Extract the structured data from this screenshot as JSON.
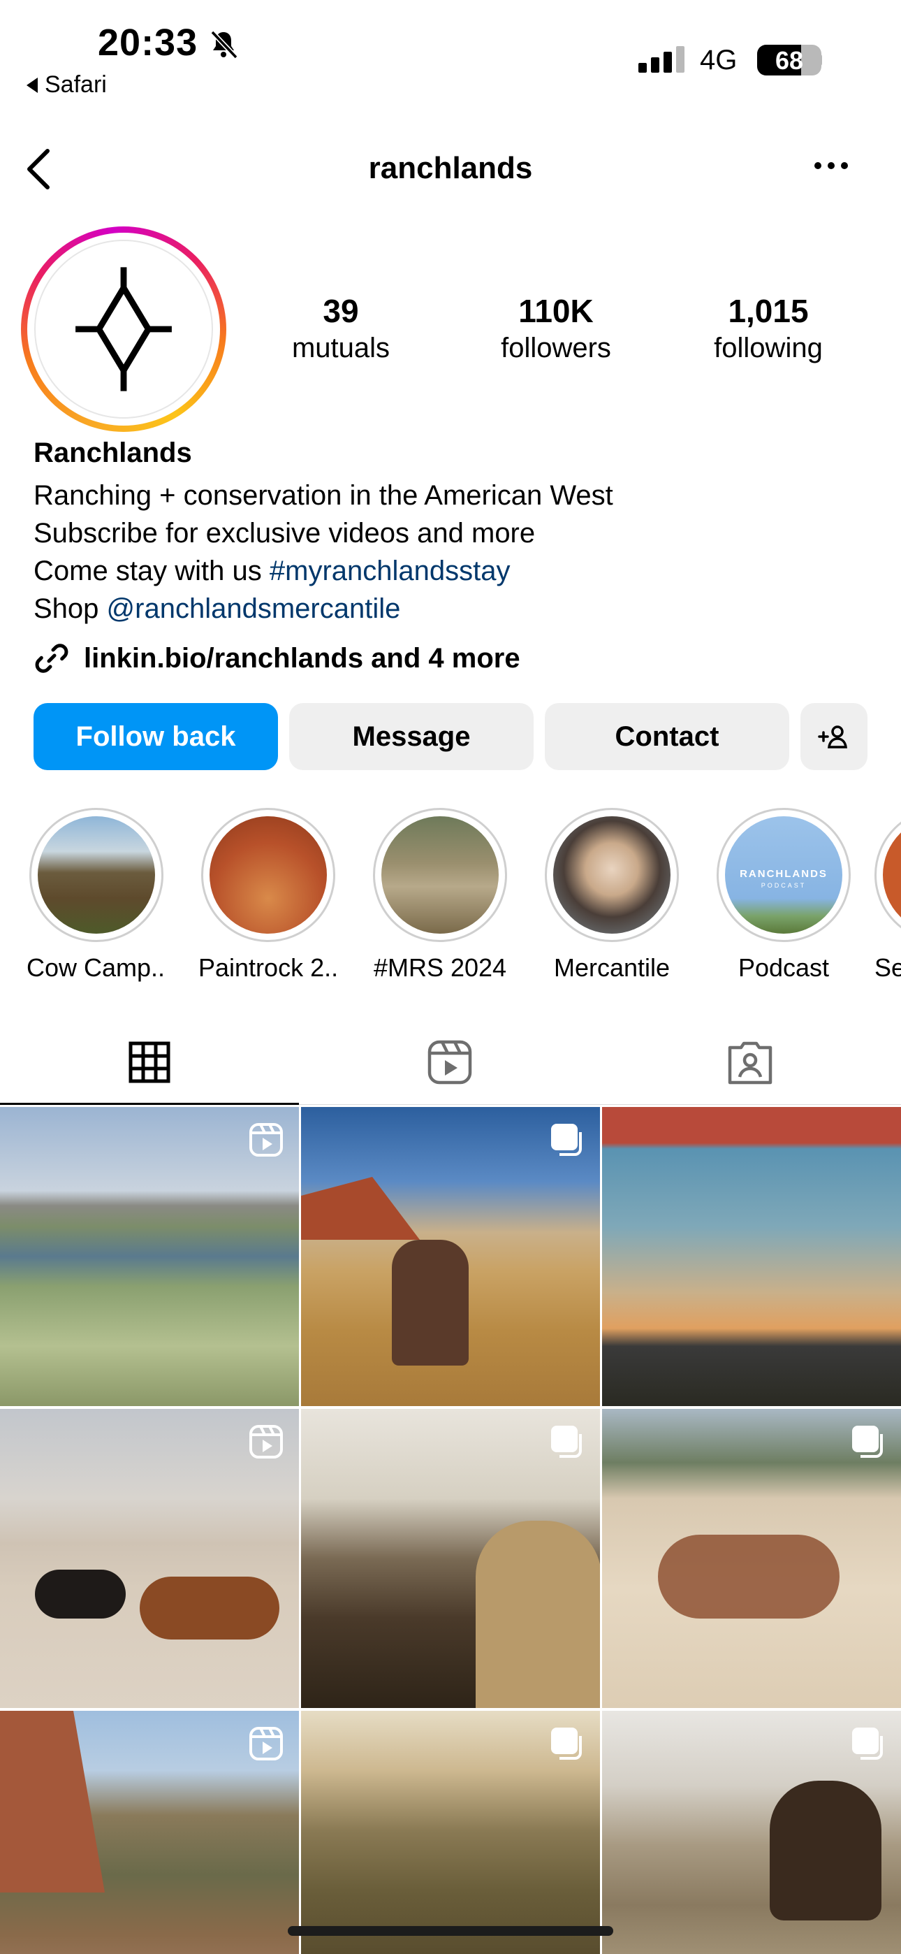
{
  "status_bar": {
    "time": "20:33",
    "back_app": "Safari",
    "network": "4G",
    "battery": "68",
    "battery_level": 0.68
  },
  "header": {
    "username": "ranchlands"
  },
  "profile": {
    "display_name": "Ranchlands",
    "stats": [
      {
        "value": "39",
        "label": "mutuals"
      },
      {
        "value": "110K",
        "label": "followers"
      },
      {
        "value": "1,015",
        "label": "following"
      }
    ],
    "bio": {
      "line1": "Ranching + conservation in the American West",
      "line2": "Subscribe for exclusive videos and more",
      "line3_prefix": "Come stay with us ",
      "line3_hashtag": "#myranchlandsstay",
      "line4_prefix": "Shop ",
      "line4_mention": "@ranchlandsmercantile"
    },
    "links_text": "linkin.bio/ranchlands and 4 more"
  },
  "actions": {
    "follow_back": "Follow back",
    "message": "Message",
    "contact": "Contact"
  },
  "highlights": [
    {
      "label": "Cow Camp..."
    },
    {
      "label": "Paintrock 2..."
    },
    {
      "label": "#MRS 2024"
    },
    {
      "label": "Mercantile"
    },
    {
      "label": "Podcast"
    },
    {
      "label": "Se"
    }
  ],
  "podcast_highlight": {
    "brand": "RANCHLANDS",
    "sub": "PODCAST"
  },
  "tabs": [
    "posts-grid",
    "reels",
    "tagged"
  ],
  "posts": [
    {
      "type": "reel"
    },
    {
      "type": "carousel"
    },
    {
      "type": "image"
    },
    {
      "type": "reel"
    },
    {
      "type": "carousel"
    },
    {
      "type": "carousel"
    },
    {
      "type": "reel"
    },
    {
      "type": "carousel"
    },
    {
      "type": "carousel"
    }
  ],
  "colors": {
    "accent_blue": "#0095f6",
    "link_blue": "#00376b",
    "button_gray": "#efefef"
  }
}
